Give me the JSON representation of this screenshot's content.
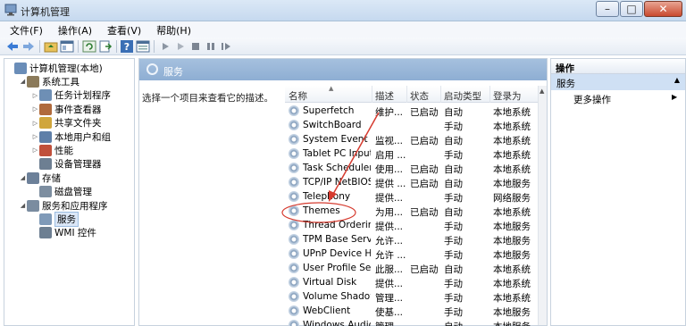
{
  "window": {
    "title": "计算机管理",
    "controls": {
      "minimize": "–",
      "maximize": "□",
      "close": "✕"
    }
  },
  "menu": [
    "文件(F)",
    "操作(A)",
    "查看(V)",
    "帮助(H)"
  ],
  "toolbar": {
    "icons": [
      "back-arrow-icon",
      "forward-arrow-icon",
      "up-folder-icon",
      "show-hide-tree-icon",
      "refresh-icon",
      "export-icon",
      "help-icon",
      "properties-icon",
      "play-icon",
      "play-outline-icon",
      "stop-icon",
      "pause-icon",
      "restart-icon"
    ]
  },
  "tree": {
    "items": [
      {
        "label": "计算机管理(本地)",
        "indent": 0,
        "arrow": "",
        "icon": "computer-mgmt-icon",
        "color": "#6a8db8"
      },
      {
        "label": "系统工具",
        "indent": 1,
        "arrow": "◢",
        "icon": "tools-icon",
        "color": "#8b7a5a"
      },
      {
        "label": "任务计划程序",
        "indent": 2,
        "arrow": "▷",
        "icon": "clock-icon",
        "color": "#6e8fb5"
      },
      {
        "label": "事件查看器",
        "indent": 2,
        "arrow": "▷",
        "icon": "event-viewer-icon",
        "color": "#b06a3c"
      },
      {
        "label": "共享文件夹",
        "indent": 2,
        "arrow": "▷",
        "icon": "shared-folder-icon",
        "color": "#d0a63c"
      },
      {
        "label": "本地用户和组",
        "indent": 2,
        "arrow": "▷",
        "icon": "users-icon",
        "color": "#5e7fa8"
      },
      {
        "label": "性能",
        "indent": 2,
        "arrow": "▷",
        "icon": "performance-icon",
        "color": "#c0503b"
      },
      {
        "label": "设备管理器",
        "indent": 2,
        "arrow": "",
        "icon": "device-manager-icon",
        "color": "#6d7f92"
      },
      {
        "label": "存储",
        "indent": 1,
        "arrow": "◢",
        "icon": "storage-icon",
        "color": "#6c8099"
      },
      {
        "label": "磁盘管理",
        "indent": 2,
        "arrow": "",
        "icon": "disk-icon",
        "color": "#7d8ea0"
      },
      {
        "label": "服务和应用程序",
        "indent": 1,
        "arrow": "◢",
        "icon": "services-apps-icon",
        "color": "#7a8ca0"
      },
      {
        "label": "服务",
        "indent": 2,
        "arrow": "",
        "icon": "service-gear-icon",
        "color": "#7f9ab8",
        "selected": true
      },
      {
        "label": "WMI 控件",
        "indent": 2,
        "arrow": "",
        "icon": "wmi-icon",
        "color": "#6d7f92"
      }
    ]
  },
  "main": {
    "header": "服务",
    "description": "选择一个项目来查看它的描述。",
    "columns": [
      "名称",
      "描述",
      "状态",
      "启动类型",
      "登录为"
    ],
    "rows": [
      {
        "name": "Superfetch",
        "desc": "维护...",
        "status": "已启动",
        "startup": "自动",
        "logon": "本地系统"
      },
      {
        "name": "SwitchBoard",
        "desc": "",
        "status": "",
        "startup": "手动",
        "logon": "本地系统"
      },
      {
        "name": "System Event N...",
        "desc": "监视...",
        "status": "已启动",
        "startup": "自动",
        "logon": "本地系统"
      },
      {
        "name": "Tablet PC Input ...",
        "desc": "启用 ...",
        "status": "",
        "startup": "手动",
        "logon": "本地系统"
      },
      {
        "name": "Task Scheduler",
        "desc": "使用...",
        "status": "已启动",
        "startup": "自动",
        "logon": "本地系统"
      },
      {
        "name": "TCP/IP NetBIOS ...",
        "desc": "提供 ...",
        "status": "已启动",
        "startup": "自动",
        "logon": "本地服务"
      },
      {
        "name": "Telephony",
        "desc": "提供...",
        "status": "",
        "startup": "手动",
        "logon": "网络服务"
      },
      {
        "name": "Themes",
        "desc": "为用...",
        "status": "已启动",
        "startup": "自动",
        "logon": "本地系统"
      },
      {
        "name": "Thread Orderin...",
        "desc": "提供...",
        "status": "",
        "startup": "手动",
        "logon": "本地服务"
      },
      {
        "name": "TPM Base Servic...",
        "desc": "允许...",
        "status": "",
        "startup": "手动",
        "logon": "本地服务"
      },
      {
        "name": "UPnP Device Host",
        "desc": "允许 ...",
        "status": "",
        "startup": "手动",
        "logon": "本地服务"
      },
      {
        "name": "User Profile Serv...",
        "desc": "此服...",
        "status": "已启动",
        "startup": "自动",
        "logon": "本地系统"
      },
      {
        "name": "Virtual Disk",
        "desc": "提供...",
        "status": "",
        "startup": "手动",
        "logon": "本地系统"
      },
      {
        "name": "Volume Shadow...",
        "desc": "管理...",
        "status": "",
        "startup": "手动",
        "logon": "本地系统"
      },
      {
        "name": "WebClient",
        "desc": "使基...",
        "status": "",
        "startup": "手动",
        "logon": "本地服务"
      },
      {
        "name": "Windows Audio",
        "desc": "管理...",
        "status": "",
        "startup": "自动",
        "logon": "本地服务"
      }
    ]
  },
  "actions": {
    "header": "操作",
    "section": "服务",
    "collapse_glyph": "▲",
    "more": "更多操作",
    "more_arrow": "▶"
  },
  "colors": {
    "annotation": "#d63b2f",
    "header_blue": "#8eaed3",
    "selected": "#dbe7f7"
  }
}
